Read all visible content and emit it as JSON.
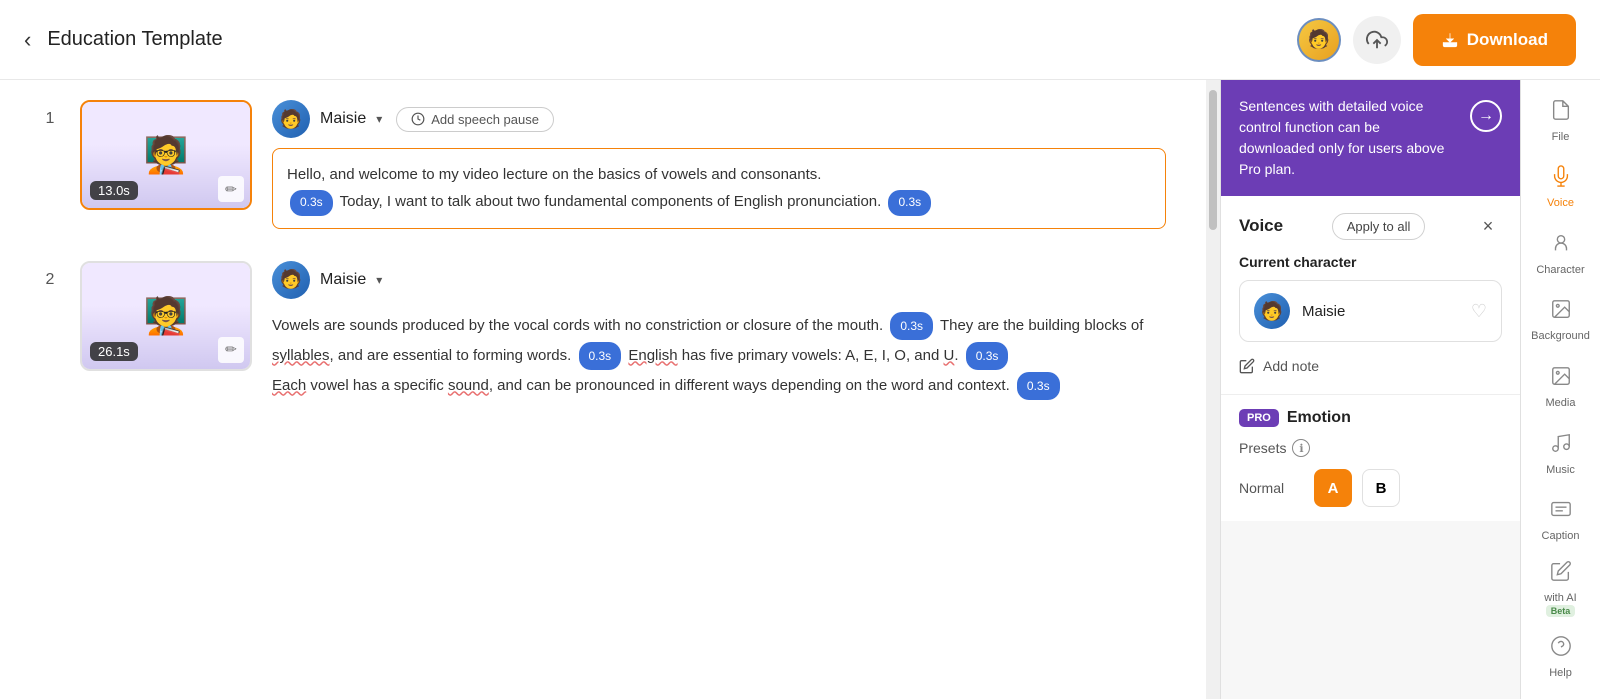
{
  "header": {
    "back_label": "‹",
    "title": "Education Template",
    "download_label": "Download",
    "download_icon": "⬇"
  },
  "pro_banner": {
    "text": "Sentences with detailed voice control function can be downloaded only for users above Pro plan.",
    "arrow": "→"
  },
  "voice_panel": {
    "title": "Voice",
    "apply_all_label": "Apply to all",
    "close_icon": "×",
    "current_character_label": "Current character",
    "character_name": "Maisie",
    "add_note_label": "Add note"
  },
  "emotion_section": {
    "pro_badge": "PRO",
    "title": "Emotion",
    "presets_label": "Presets",
    "info": "ℹ",
    "normal_label": "Normal",
    "preset_a": "A",
    "preset_b": "B"
  },
  "scenes": [
    {
      "number": "1",
      "duration": "13.0s",
      "speaker": "Maisie",
      "highlighted_text": "Hello, and welcome to my video lecture on the basics of vowels and consonants.",
      "text_after": [
        {
          "type": "pause",
          "value": "0.3s"
        },
        {
          "type": "text",
          "value": " Today, I want to talk about two fundamental components of English pronunciation. "
        },
        {
          "type": "pause",
          "value": "0.3s"
        }
      ]
    },
    {
      "number": "2",
      "duration": "26.1s",
      "speaker": "Maisie",
      "text_lines": "Vowels are sounds produced by the vocal cords with no constriction or closure of the mouth.",
      "text_continuation": [
        {
          "type": "pause",
          "value": "0.3s"
        },
        {
          "type": "text",
          "value": " They are the building blocks of "
        },
        {
          "type": "underline",
          "value": "syllables"
        },
        {
          "type": "text",
          "value": ", and are essential to forming words. "
        },
        {
          "type": "pause",
          "value": "0.3s"
        },
        {
          "type": "text",
          "value": " "
        },
        {
          "type": "underline",
          "value": "English"
        },
        {
          "type": "text",
          "value": " has five primary vowels: A, E, I, O, and "
        },
        {
          "type": "underline",
          "value": "U"
        },
        {
          "type": "text",
          "value": ". "
        },
        {
          "type": "pause",
          "value": "0.3s"
        },
        {
          "type": "newline"
        },
        {
          "type": "underline",
          "value": "Each"
        },
        {
          "type": "text",
          "value": " vowel has a specific "
        },
        {
          "type": "underline",
          "value": "sound"
        },
        {
          "type": "text",
          "value": ", and can be pronounced in different ways depending on the word and context. "
        },
        {
          "type": "pause",
          "value": "0.3s"
        }
      ]
    }
  ],
  "far_right_sidebar": {
    "items": [
      {
        "id": "file",
        "label": "File",
        "icon": "📄"
      },
      {
        "id": "voice",
        "label": "Voice",
        "icon": "🎙",
        "active": true
      },
      {
        "id": "character",
        "label": "Character",
        "icon": "😊"
      },
      {
        "id": "background",
        "label": "Background",
        "icon": "🖼"
      },
      {
        "id": "media",
        "label": "Media",
        "icon": "🖼"
      },
      {
        "id": "music",
        "label": "Music",
        "icon": "🎵"
      },
      {
        "id": "caption",
        "label": "Caption",
        "icon": "⊞"
      },
      {
        "id": "ai",
        "label": "with AI",
        "icon": "✏",
        "beta": true
      },
      {
        "id": "help",
        "label": "Help",
        "icon": "❓"
      }
    ]
  },
  "add_pause_label": "Add speech pause"
}
